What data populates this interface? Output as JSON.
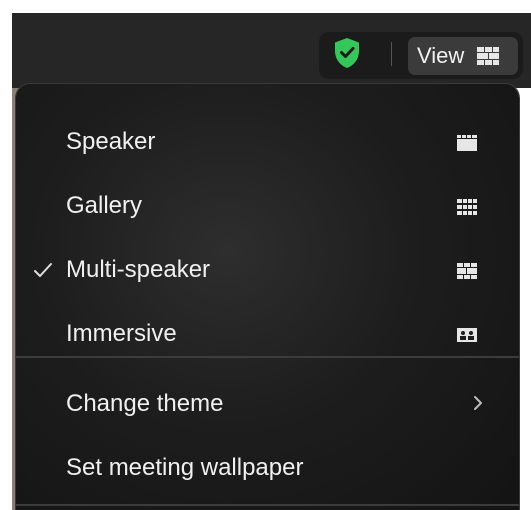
{
  "toolbar": {
    "view_label": "View",
    "shield_color": "#2ecc71"
  },
  "menu": {
    "items": [
      {
        "label": "Speaker",
        "icon": "speaker-view-icon",
        "checked": false
      },
      {
        "label": "Gallery",
        "icon": "gallery-view-icon",
        "checked": false
      },
      {
        "label": "Multi-speaker",
        "icon": "multi-speaker-view-icon",
        "checked": true
      },
      {
        "label": "Immersive",
        "icon": "immersive-view-icon",
        "checked": false
      }
    ],
    "secondary": [
      {
        "label": "Change theme",
        "icon": "chevron-right-icon"
      },
      {
        "label": "Set meeting wallpaper"
      }
    ]
  }
}
